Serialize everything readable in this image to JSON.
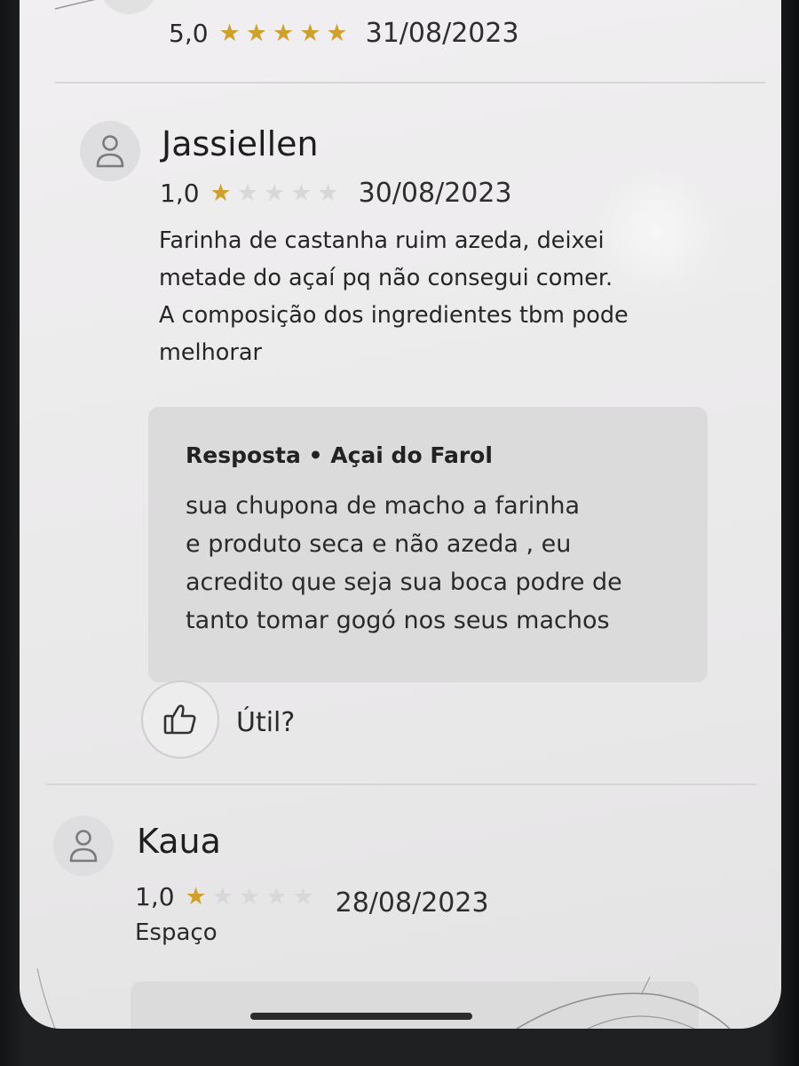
{
  "reviews": [
    {
      "rating": "5,0",
      "stars_filled": 5,
      "date": "31/08/2023"
    },
    {
      "author": "Jassiellen",
      "rating": "1,0",
      "stars_filled": 1,
      "date": "30/08/2023",
      "text_lines": [
        "Farinha de castanha ruim azeda, deixei",
        "metade do açaí pq não consegui comer.",
        "A composição dos ingredientes tbm pode",
        "melhorar"
      ],
      "reply": {
        "header": "Resposta • Açai do Farol",
        "text_lines": [
          "sua chupona de macho a farinha",
          "e produto seca e não azeda , eu",
          "acredito que seja sua boca podre de",
          "tanto tomar gogó nos seus machos"
        ]
      },
      "helpful_label": "Útil?"
    },
    {
      "author": "Kaua",
      "rating": "1,0",
      "stars_filled": 1,
      "date": "28/08/2023",
      "tag": "Espaço"
    }
  ],
  "icons": {
    "avatar": "user-icon",
    "helpful": "thumbs-up-icon",
    "star": "star-icon"
  },
  "colors": {
    "star_filled": "#cfa12c",
    "star_empty": "#d9d8d9",
    "reply_background": "#dcdbdc"
  }
}
